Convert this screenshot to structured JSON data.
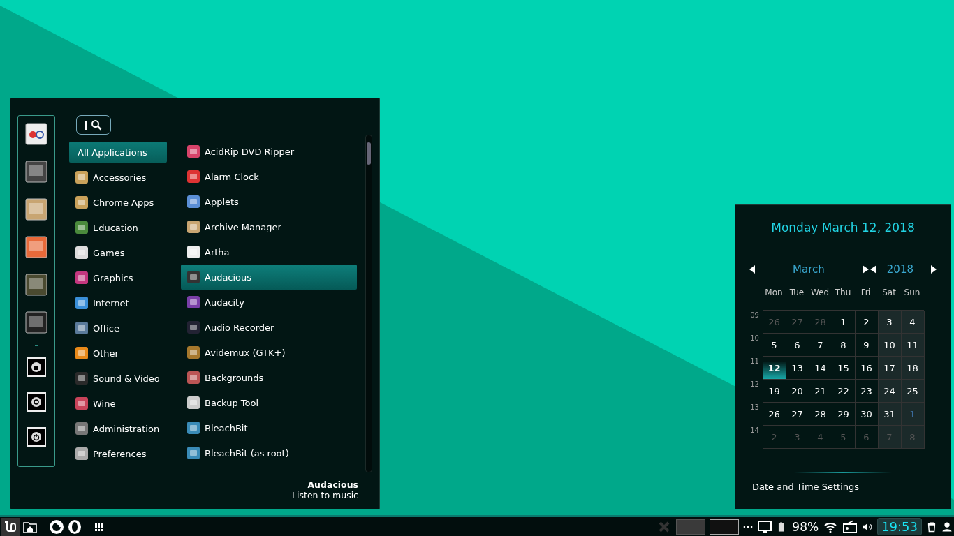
{
  "menu": {
    "categories": [
      {
        "label": "All Applications",
        "selected": true
      },
      {
        "label": "Accessories",
        "selected": false
      },
      {
        "label": "Chrome Apps",
        "selected": false
      },
      {
        "label": "Education",
        "selected": false
      },
      {
        "label": "Games",
        "selected": false
      },
      {
        "label": "Graphics",
        "selected": false
      },
      {
        "label": "Internet",
        "selected": false
      },
      {
        "label": "Office",
        "selected": false
      },
      {
        "label": "Other",
        "selected": false
      },
      {
        "label": "Sound & Video",
        "selected": false
      },
      {
        "label": "Wine",
        "selected": false
      },
      {
        "label": "Administration",
        "selected": false
      },
      {
        "label": "Preferences",
        "selected": false
      }
    ],
    "apps": [
      {
        "label": "AcidRip DVD Ripper",
        "selected": false
      },
      {
        "label": "Alarm Clock",
        "selected": false
      },
      {
        "label": "Applets",
        "selected": false
      },
      {
        "label": "Archive Manager",
        "selected": false
      },
      {
        "label": "Artha",
        "selected": false
      },
      {
        "label": "Audacious",
        "selected": true
      },
      {
        "label": "Audacity",
        "selected": false
      },
      {
        "label": "Audio Recorder",
        "selected": false
      },
      {
        "label": "Avidemux (GTK+)",
        "selected": false
      },
      {
        "label": "Backgrounds",
        "selected": false
      },
      {
        "label": "Backup Tool",
        "selected": false
      },
      {
        "label": "BleachBit",
        "selected": false
      },
      {
        "label": "BleachBit (as root)",
        "selected": false
      }
    ],
    "app_info": {
      "name": "Audacious",
      "description": "Listen to music"
    }
  },
  "calendar": {
    "date_title": "Monday March 12, 2018",
    "month": "March",
    "year": "2018",
    "weekdays": [
      "Mon",
      "Tue",
      "Wed",
      "Thu",
      "Fri",
      "Sat",
      "Sun"
    ],
    "week_numbers": [
      "09",
      "10",
      "11",
      "12",
      "13",
      "14"
    ],
    "days": [
      {
        "label": "26",
        "other_month": true,
        "selected": false
      },
      {
        "label": "27",
        "other_month": true,
        "selected": false
      },
      {
        "label": "28",
        "other_month": true,
        "selected": false
      },
      {
        "label": "1",
        "other_month": false,
        "selected": false
      },
      {
        "label": "2",
        "other_month": false,
        "selected": false
      },
      {
        "label": "3",
        "other_month": false,
        "selected": false
      },
      {
        "label": "4",
        "other_month": false,
        "selected": false
      },
      {
        "label": "5",
        "other_month": false,
        "selected": false
      },
      {
        "label": "6",
        "other_month": false,
        "selected": false
      },
      {
        "label": "7",
        "other_month": false,
        "selected": false
      },
      {
        "label": "8",
        "other_month": false,
        "selected": false
      },
      {
        "label": "9",
        "other_month": false,
        "selected": false
      },
      {
        "label": "10",
        "other_month": false,
        "selected": false
      },
      {
        "label": "11",
        "other_month": false,
        "selected": false
      },
      {
        "label": "12",
        "other_month": false,
        "selected": true
      },
      {
        "label": "13",
        "other_month": false,
        "selected": false
      },
      {
        "label": "14",
        "other_month": false,
        "selected": false
      },
      {
        "label": "15",
        "other_month": false,
        "selected": false
      },
      {
        "label": "16",
        "other_month": false,
        "selected": false
      },
      {
        "label": "17",
        "other_month": false,
        "selected": false
      },
      {
        "label": "18",
        "other_month": false,
        "selected": false
      },
      {
        "label": "19",
        "other_month": false,
        "selected": false
      },
      {
        "label": "20",
        "other_month": false,
        "selected": false
      },
      {
        "label": "21",
        "other_month": false,
        "selected": false
      },
      {
        "label": "22",
        "other_month": false,
        "selected": false
      },
      {
        "label": "23",
        "other_month": false,
        "selected": false
      },
      {
        "label": "24",
        "other_month": false,
        "selected": false
      },
      {
        "label": "25",
        "other_month": false,
        "selected": false
      },
      {
        "label": "26",
        "other_month": false,
        "selected": false
      },
      {
        "label": "27",
        "other_month": false,
        "selected": false
      },
      {
        "label": "28",
        "other_month": false,
        "selected": false
      },
      {
        "label": "29",
        "other_month": false,
        "selected": false
      },
      {
        "label": "30",
        "other_month": false,
        "selected": false
      },
      {
        "label": "31",
        "other_month": false,
        "selected": false
      },
      {
        "label": "1",
        "other_month": true,
        "selected": false
      },
      {
        "label": "2",
        "other_month": true,
        "selected": false
      },
      {
        "label": "3",
        "other_month": true,
        "selected": false
      },
      {
        "label": "4",
        "other_month": true,
        "selected": false
      },
      {
        "label": "5",
        "other_month": true,
        "selected": false
      },
      {
        "label": "6",
        "other_month": true,
        "selected": false
      },
      {
        "label": "7",
        "other_month": true,
        "selected": false
      },
      {
        "label": "8",
        "other_month": true,
        "selected": false
      }
    ],
    "settings_link": "Date and Time Settings"
  },
  "taskbar": {
    "workspaces": [
      {
        "selected": false
      },
      {
        "selected": true
      }
    ],
    "battery": "98%",
    "clock": "19:53",
    "clock_active": true
  }
}
